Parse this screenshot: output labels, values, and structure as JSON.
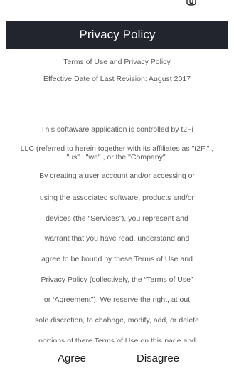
{
  "header": {
    "title": "Privacy Policy"
  },
  "status_bar": {
    "icon": "status-icon"
  },
  "document": {
    "heading": "Terms of Use and Privacy Policy",
    "effective_date": "Effective Date of Last Revision: August 2017",
    "lines": [
      "This softaware application is controlled by t2Fi",
      "LLC (referred to herein together with its affiliates as  \"t2Fi\" ,",
      "\"us\" , \"we\" , or the \"Company\".",
      "By creating a user account and/or accessing or",
      "using the associated software, products and/or",
      "devices (the “Services”), you represent and",
      "warrant that you have read, understand and",
      "agree to be bound by these Terms of Use and",
      "Privacy Policy (collectively, the “Terms of Use”",
      "or ‘Agreement”). We reserve the right, at out",
      "sole discretion, to chahnge, modify, add, or delete",
      "portions of there Terms of Use on this page and"
    ]
  },
  "actions": {
    "agree_label": "Agree",
    "disagree_label": "Disagree"
  },
  "colors": {
    "title_bar": "#22242e",
    "title_text": "#ffffff",
    "body_text": "#595959"
  }
}
